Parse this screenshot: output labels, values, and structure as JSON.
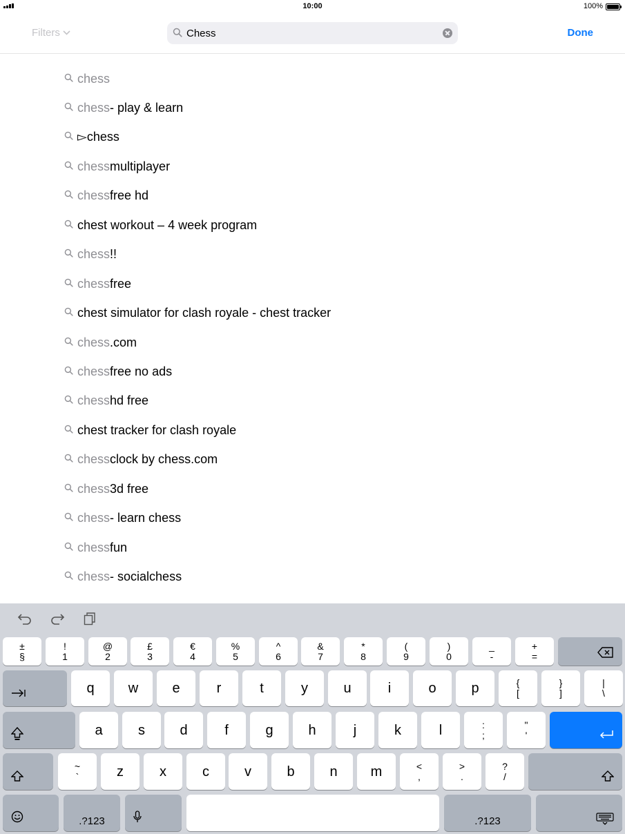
{
  "status": {
    "time": "10:00",
    "battery": "100%"
  },
  "header": {
    "filters_label": "Filters",
    "search_value": "Chess",
    "done_label": "Done"
  },
  "suggestions": [
    {
      "typed": "chess",
      "rest": ""
    },
    {
      "typed": "chess",
      "rest": " - play & learn"
    },
    {
      "typed": "",
      "rest": "▻chess"
    },
    {
      "typed": "chess",
      "rest": " multiplayer"
    },
    {
      "typed": "chess",
      "rest": " free hd"
    },
    {
      "typed": "",
      "rest": "chest workout – 4 week program"
    },
    {
      "typed": "chess",
      "rest": "!!"
    },
    {
      "typed": "chess",
      "rest": " free"
    },
    {
      "typed": "",
      "rest": "chest simulator for clash royale - chest tracker"
    },
    {
      "typed": "chess",
      "rest": ".com"
    },
    {
      "typed": "chess",
      "rest": " free no ads"
    },
    {
      "typed": "chess",
      "rest": " hd free"
    },
    {
      "typed": "",
      "rest": "chest tracker for clash royale"
    },
    {
      "typed": "chess",
      "rest": " clock by chess.com"
    },
    {
      "typed": "chess",
      "rest": " 3d free"
    },
    {
      "typed": "chess",
      "rest": " - learn chess"
    },
    {
      "typed": "chess",
      "rest": " fun"
    },
    {
      "typed": "chess",
      "rest": " - socialchess"
    }
  ],
  "keyboard": {
    "toolbar": [
      "undo-icon",
      "redo-icon",
      "paste-icon"
    ],
    "number_row": [
      {
        "top": "±",
        "bottom": "§"
      },
      {
        "top": "!",
        "bottom": "1"
      },
      {
        "top": "@",
        "bottom": "2"
      },
      {
        "top": "£",
        "bottom": "3"
      },
      {
        "top": "€",
        "bottom": "4"
      },
      {
        "top": "%",
        "bottom": "5"
      },
      {
        "top": "^",
        "bottom": "6"
      },
      {
        "top": "&",
        "bottom": "7"
      },
      {
        "top": "*",
        "bottom": "8"
      },
      {
        "top": "(",
        "bottom": "9"
      },
      {
        "top": ")",
        "bottom": "0"
      },
      {
        "top": "_",
        "bottom": "-"
      },
      {
        "top": "+",
        "bottom": "="
      }
    ],
    "row_q": [
      "q",
      "w",
      "e",
      "r",
      "t",
      "y",
      "u",
      "i",
      "o",
      "p"
    ],
    "row_q_extra": [
      {
        "top": "{",
        "bottom": "["
      },
      {
        "top": "}",
        "bottom": "]"
      },
      {
        "top": "|",
        "bottom": "\\"
      }
    ],
    "row_a": [
      "a",
      "s",
      "d",
      "f",
      "g",
      "h",
      "j",
      "k",
      "l"
    ],
    "row_a_extra": [
      {
        "top": ":",
        "bottom": ";"
      },
      {
        "top": "\"",
        "bottom": "'"
      }
    ],
    "row_z_pre": {
      "top": "~",
      "bottom": "`"
    },
    "row_z": [
      "z",
      "x",
      "c",
      "v",
      "b",
      "n",
      "m"
    ],
    "row_z_extra": [
      {
        "top": "<",
        "bottom": ","
      },
      {
        "top": ">",
        "bottom": "."
      },
      {
        "top": "?",
        "bottom": "/"
      }
    ],
    "numbers_label": ".?123"
  }
}
